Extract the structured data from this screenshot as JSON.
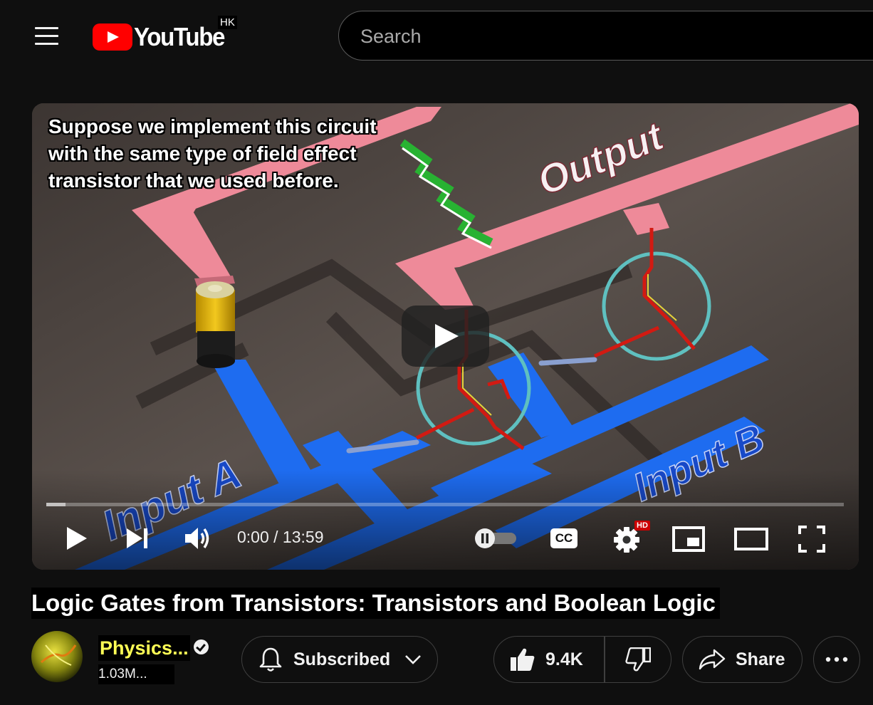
{
  "header": {
    "logo_text": "YouTube",
    "region": "HK",
    "search_placeholder": "Search"
  },
  "player": {
    "caption_lines": [
      "Suppose we implement this circuit",
      "with the same type of field effect",
      "transistor that we used before."
    ],
    "scene_labels": {
      "output": "Output",
      "input_a": "Input A",
      "input_b": "Input B"
    },
    "time": "0:00 / 13:59",
    "hd_badge": "HD",
    "cc_label": "CC",
    "progress_loaded_fraction": 0.024
  },
  "video": {
    "title": "Logic Gates from Transistors: Transistors and Boolean Logic"
  },
  "channel": {
    "name": "Physics...",
    "subscribers": "1.03M..."
  },
  "actions": {
    "subscribe_label": "Subscribed",
    "like_count": "9.4K",
    "share_label": "Share"
  },
  "icons": {
    "menu": "hamburger-icon",
    "play": "play-icon",
    "next": "next-icon",
    "volume": "volume-icon",
    "autoplay": "autoplay-toggle",
    "captions": "cc-icon",
    "settings": "gear-icon",
    "miniplayer": "miniplayer-icon",
    "theater": "theater-icon",
    "fullscreen": "fullscreen-icon",
    "bell": "bell-icon",
    "like": "thumbs-up-icon",
    "dislike": "thumbs-down-icon",
    "share": "share-icon",
    "more": "more-icon"
  },
  "colors": {
    "background": "#0f0f0f",
    "brand_red": "#ff0000",
    "output_wire": "#ee8a99",
    "input_wire": "#1e6cf0",
    "transistor_ring": "#5fc0c0",
    "channel_name": "#ffff55"
  }
}
